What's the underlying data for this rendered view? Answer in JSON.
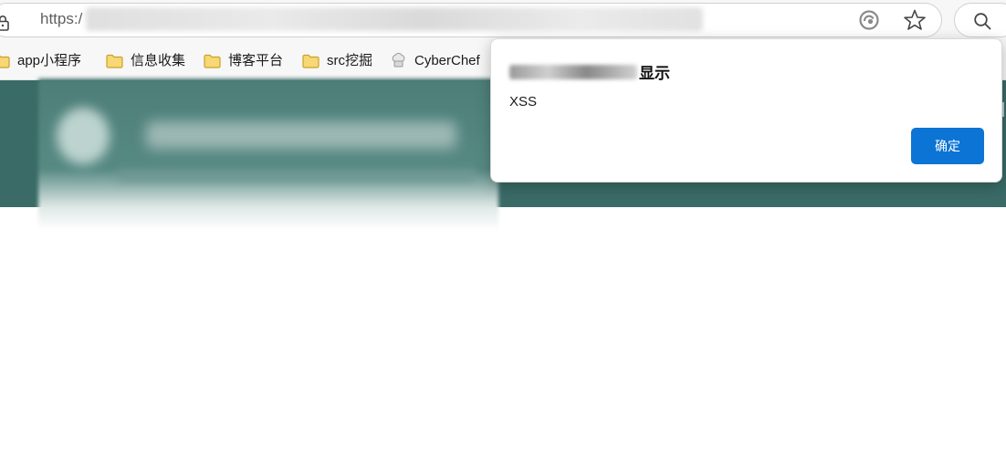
{
  "address_bar": {
    "url_prefix": "https:/",
    "lock_icon": "lock-icon",
    "edge_icon": "edge-refresh-icon",
    "favorite_icon": "star-icon",
    "search_icon": "search-icon"
  },
  "bookmarks": [
    {
      "label": "app小程序",
      "icon": "folder-icon"
    },
    {
      "label": "信息收集",
      "icon": "folder-icon"
    },
    {
      "label": "博客平台",
      "icon": "folder-icon"
    },
    {
      "label": "src挖掘",
      "icon": "folder-icon"
    },
    {
      "label": "CyberChef",
      "icon": "chef-icon"
    }
  ],
  "dialog": {
    "title_suffix": "显示",
    "message": "XSS",
    "ok_label": "确定"
  },
  "colors": {
    "header_band": "#3a6b66",
    "ok_button": "#0b74d4",
    "folder_fill": "#f8d775",
    "folder_stroke": "#c9a227"
  }
}
